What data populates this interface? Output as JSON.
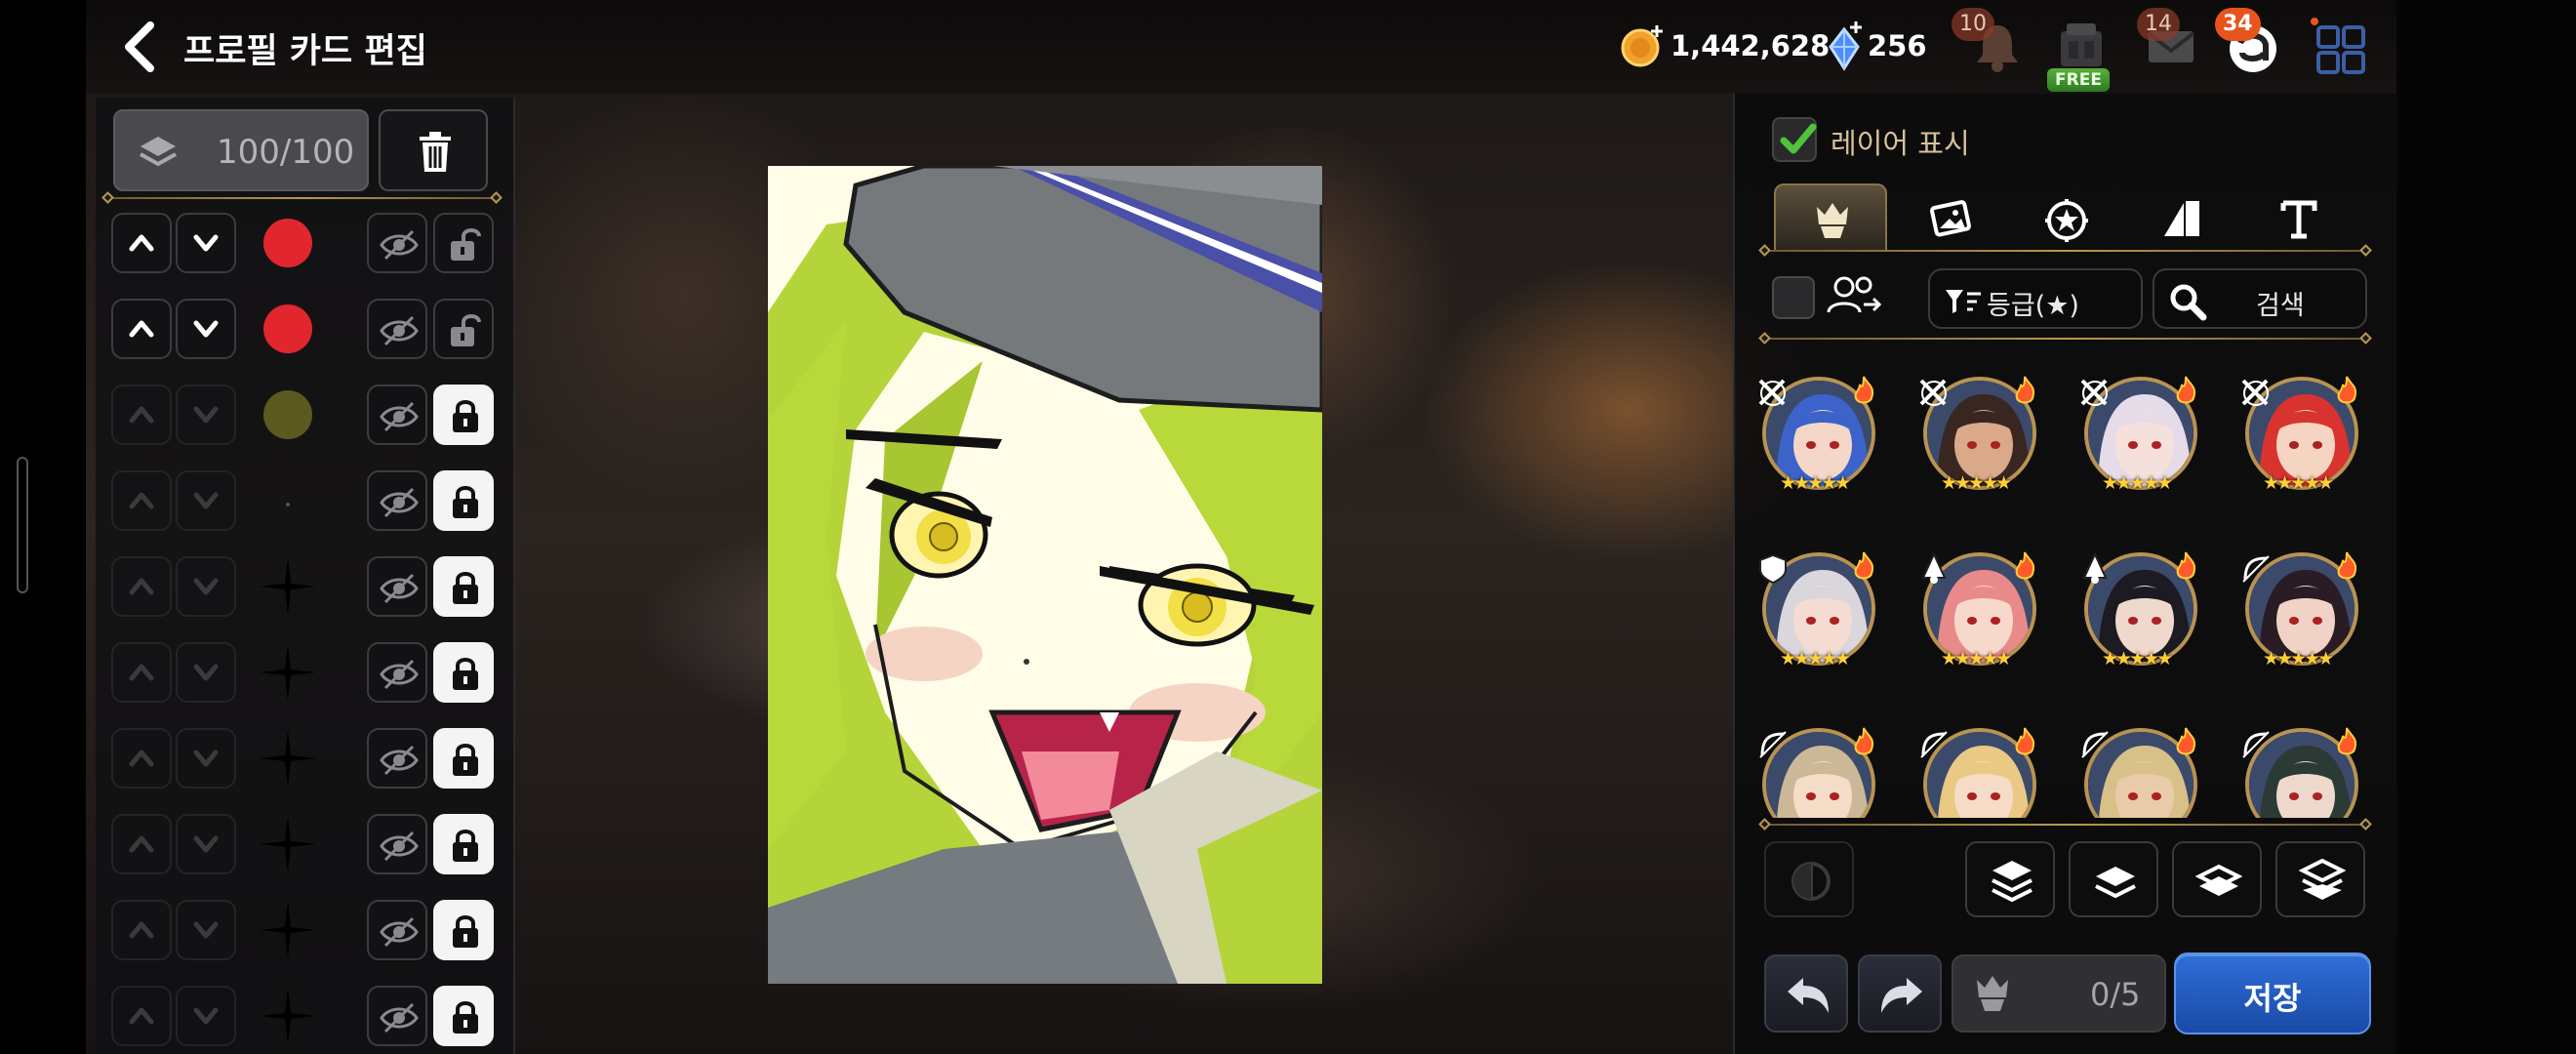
{
  "header": {
    "title": "프로필 카드 편집",
    "coins": "1,442,628",
    "gems": "256",
    "bell_badge": "10",
    "shop_free": "FREE",
    "mail_badge": "14",
    "chat_badge": "34"
  },
  "layers": {
    "count": "100/100",
    "rows": [
      {
        "preview": "red-circle",
        "color": "#e2262e",
        "movable": true,
        "locked": false
      },
      {
        "preview": "red-circle",
        "color": "#e2262e",
        "movable": true,
        "locked": false
      },
      {
        "preview": "olive-circle",
        "color": "#5b5a1e",
        "movable": false,
        "locked": true
      },
      {
        "preview": "dot",
        "color": "#222222",
        "movable": false,
        "locked": true
      },
      {
        "preview": "sparkle",
        "color": "#000000",
        "movable": false,
        "locked": true
      },
      {
        "preview": "sparkle",
        "color": "#000000",
        "movable": false,
        "locked": true
      },
      {
        "preview": "sparkle",
        "color": "#000000",
        "movable": false,
        "locked": true
      },
      {
        "preview": "sparkle",
        "color": "#000000",
        "movable": false,
        "locked": true
      },
      {
        "preview": "sparkle",
        "color": "#000000",
        "movable": false,
        "locked": true
      },
      {
        "preview": "sparkle",
        "color": "#000000",
        "movable": false,
        "locked": true
      }
    ]
  },
  "side_panel": {
    "show_layers_label": "레이어 표시",
    "show_layers_checked": true,
    "tabs": [
      "hero-icon",
      "image-icon",
      "badge-icon",
      "shape-icon",
      "text-icon"
    ],
    "active_tab": 0,
    "sort_label": "등급(★)",
    "search_label": "검색",
    "heroes": [
      {
        "hair": "#3b63c9",
        "skin": "#f4d7c8",
        "role": "dual-sword-icon",
        "stars": "★★★★★"
      },
      {
        "hair": "#3a2620",
        "skin": "#d9a98a",
        "role": "dual-sword-icon",
        "stars": "★★★★★"
      },
      {
        "hair": "#e6dbe8",
        "skin": "#f6e0dc",
        "role": "dual-sword-icon",
        "stars": "★★★★★"
      },
      {
        "hair": "#d8332e",
        "skin": "#f6d4c2",
        "role": "dual-sword-icon",
        "stars": "★★★★★"
      },
      {
        "hair": "#d9d6dc",
        "skin": "#f4dcd2",
        "role": "shield-icon",
        "stars": "★★★★★"
      },
      {
        "hair": "#e98a8a",
        "skin": "#f7d9cc",
        "role": "mage-icon",
        "stars": "★★★★★"
      },
      {
        "hair": "#1c1a22",
        "skin": "#efd8cc",
        "role": "mage-icon",
        "stars": "★★★★★"
      },
      {
        "hair": "#2a1c24",
        "skin": "#f1d2c6",
        "role": "bow-icon",
        "stars": "★★★★★"
      },
      {
        "hair": "#cbb897",
        "skin": "#f4dcc6",
        "role": "bow-icon",
        "stars": "★★★★★"
      },
      {
        "hair": "#e9c983",
        "skin": "#f6dcc7",
        "role": "bow-icon",
        "stars": "★★★★★"
      },
      {
        "hair": "#d8c189",
        "skin": "#e9caa9",
        "role": "bow-icon",
        "stars": "★★★★★"
      },
      {
        "hair": "#2b3a34",
        "skin": "#eed8cc",
        "role": "bow-icon",
        "stars": "★★★★★"
      }
    ],
    "slot_count": "0/5",
    "save_label": "저장"
  },
  "colors": {
    "accent_gold": "#b8984f",
    "save_blue": "#2a64cc",
    "canvas_hair": "#b9d93b",
    "canvas_hat": "#75797c"
  }
}
